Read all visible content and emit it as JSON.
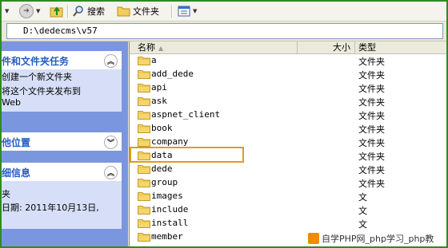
{
  "toolbar": {
    "search_label": "搜索",
    "folders_label": "文件夹"
  },
  "address": {
    "value": "D:\\dedecms\\v57"
  },
  "tasks": {
    "file_folder_tasks": {
      "title": "件和文件夹任务",
      "items": [
        "创建一个新文件夹",
        "将这个文件夹发布到",
        "Web"
      ]
    },
    "other_places": {
      "title": "他位置"
    },
    "details": {
      "title": "细信息",
      "line1": "夹",
      "line2": "日期: 2011年10月13日,"
    }
  },
  "list": {
    "col_name": "名称",
    "col_size": "大小",
    "col_type": "类型",
    "rows": [
      {
        "name": "a",
        "type": "文件夹"
      },
      {
        "name": "add_dede",
        "type": "文件夹"
      },
      {
        "name": "api",
        "type": "文件夹"
      },
      {
        "name": "ask",
        "type": "文件夹"
      },
      {
        "name": "aspnet_client",
        "type": "文件夹"
      },
      {
        "name": "book",
        "type": "文件夹"
      },
      {
        "name": "company",
        "type": "文件夹"
      },
      {
        "name": "data",
        "type": "文件夹"
      },
      {
        "name": "dede",
        "type": "文件夹"
      },
      {
        "name": "group",
        "type": "文件夹"
      },
      {
        "name": "images",
        "type": "文"
      },
      {
        "name": "include",
        "type": "文"
      },
      {
        "name": "install",
        "type": "文"
      },
      {
        "name": "member",
        "type": ""
      }
    ],
    "highlighted": "data"
  },
  "watermark": {
    "text": "自学PHP网_php学习_php教"
  },
  "colors": {
    "frame": "#2f8a23",
    "highlight": "#e29b1c",
    "pane_title": "#215dc6"
  }
}
